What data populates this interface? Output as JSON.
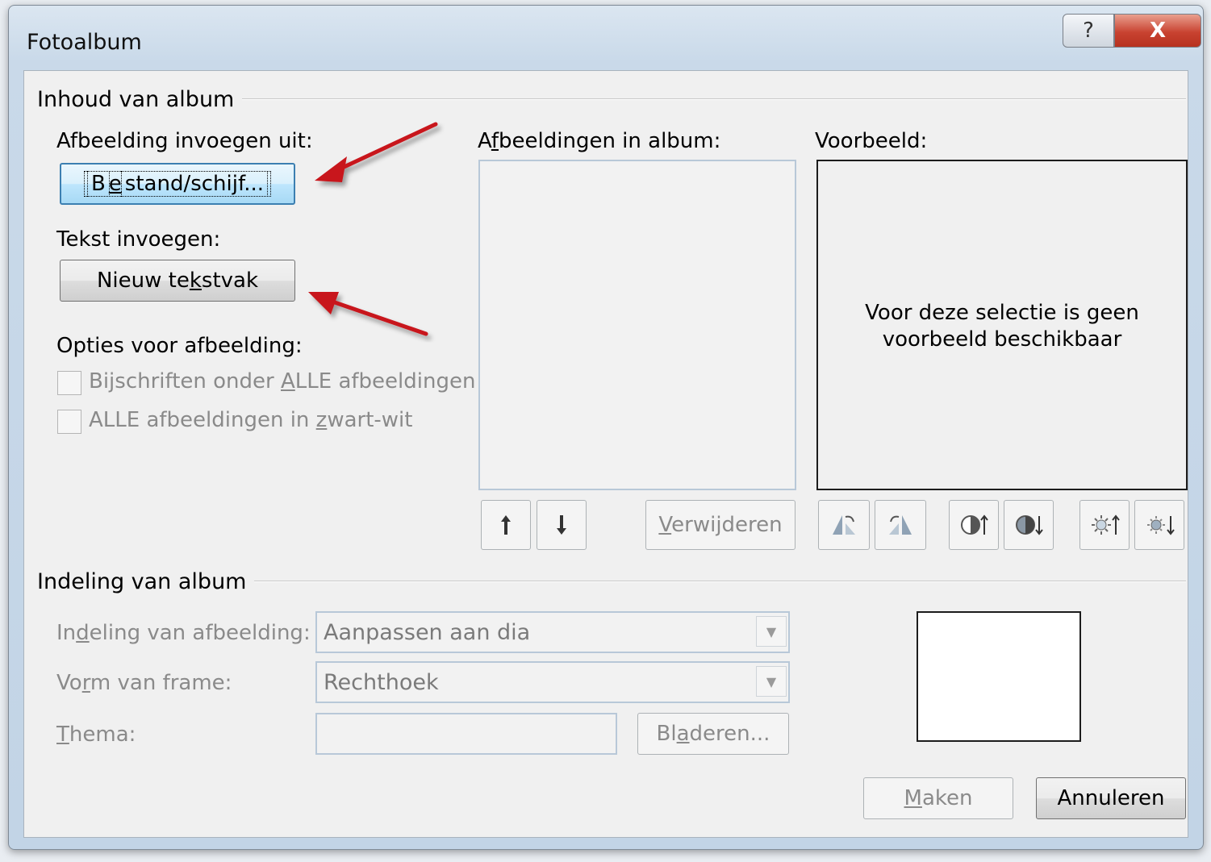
{
  "window": {
    "title": "Fotoalbum",
    "help_label": "?",
    "close_label": "X"
  },
  "content": {
    "group_label": "Inhoud van album",
    "insert_picture_label": "Afbeelding invoegen uit:",
    "file_button": {
      "pre": "B",
      "u": "e",
      "post": "stand/schijf..."
    },
    "insert_text_label": "Tekst invoegen:",
    "textbox_button": {
      "pre": "Nieuw te",
      "u": "k",
      "post": "stvak"
    },
    "options_label": "Opties voor afbeelding:",
    "captions_checkbox": {
      "pre": "Bijschriften onder ",
      "u": "A",
      "post": "LLE afbeeldingen"
    },
    "bw_checkbox": {
      "pre": "ALLE afbeeldingen in ",
      "u": "z",
      "post": "wart-wit"
    },
    "pictures_label": {
      "pre": "A",
      "u": "f",
      "post": "beeldingen in album:"
    },
    "remove_button": {
      "pre": "",
      "u": "V",
      "post": "erwijderen"
    },
    "preview_label": "Voorbeeld:",
    "preview_text_line1": "Voor deze selectie is geen",
    "preview_text_line2": "voorbeeld beschikbaar"
  },
  "layout": {
    "group_label": "Indeling van album",
    "picture_layout_label": {
      "pre": "In",
      "u": "d",
      "post": "eling van afbeelding:"
    },
    "picture_layout_value": "Aanpassen aan dia",
    "frame_shape_label": {
      "pre": "Vo",
      "u": "r",
      "post": "m van frame:"
    },
    "frame_shape_value": "Rechthoek",
    "theme_label": {
      "pre": "",
      "u": "T",
      "post": "hema:"
    },
    "theme_value": "",
    "browse_button": {
      "pre": "Bl",
      "u": "a",
      "post": "deren..."
    }
  },
  "footer": {
    "create_button": {
      "pre": "",
      "u": "M",
      "post": "aken"
    },
    "cancel_button": "Annuleren"
  },
  "colors": {
    "annotation_arrow": "#c8141c",
    "focus_border": "#3c7fb1",
    "close_button": "#c94331"
  }
}
